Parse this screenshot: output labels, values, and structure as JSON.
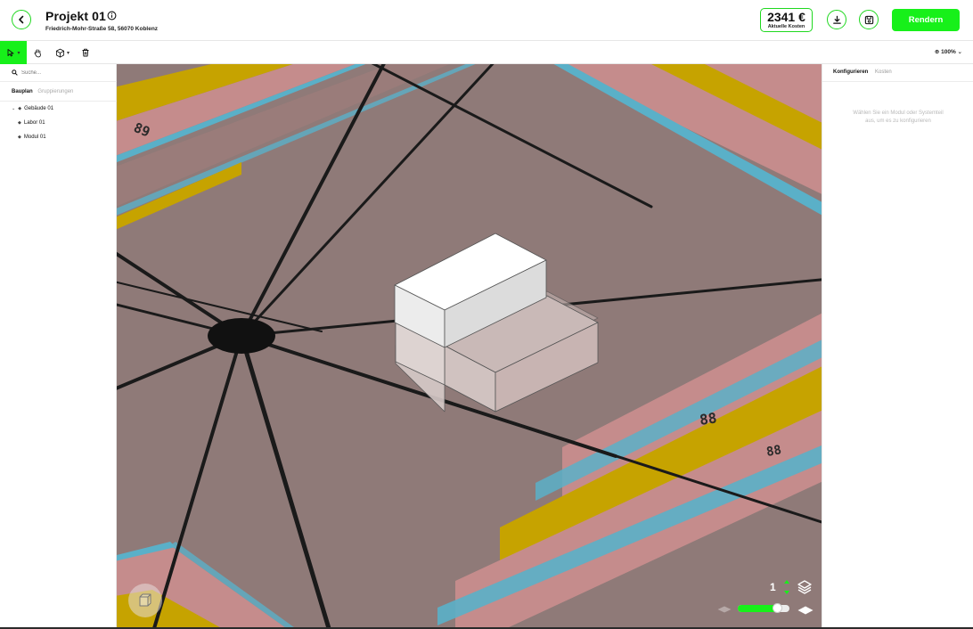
{
  "header": {
    "title": "Projekt 01",
    "address": "Friedrich-Mohr-Straße 58, 56070 Koblenz",
    "cost_value": "2341 €",
    "cost_label": "Aktuelle Kosten",
    "render_label": "Rendern",
    "icons": {
      "back": "chevron-left-icon",
      "info": "info-icon",
      "download": "download-icon",
      "save": "save-icon"
    }
  },
  "toolbar": {
    "tools": [
      "select-icon",
      "hand-icon",
      "cube-icon",
      "trash-icon"
    ],
    "zoom_label": "100%"
  },
  "sidebar_left": {
    "search_placeholder": "Suche...",
    "tabs": [
      {
        "label": "Bauplan",
        "active": true
      },
      {
        "label": "Gruppierungen",
        "active": false
      }
    ],
    "tree": [
      {
        "label": "Gebäude 01",
        "bullet": "◆",
        "expander": "⌄"
      },
      {
        "label": "Labor 01",
        "bullet": "◆"
      },
      {
        "label": "Modul 01",
        "bullet": "◆"
      }
    ]
  },
  "viewport": {
    "floor_count": "1",
    "slider_level": 0.75
  },
  "sidebar_right": {
    "tabs": [
      {
        "label": "Konfigurieren",
        "active": true
      },
      {
        "label": "Kosten",
        "active": false
      }
    ],
    "hint": "Wählen Sie ein Modul oder Systemteil aus, um es zu konfigurieren"
  },
  "colors": {
    "accent": "#17f01a",
    "ground": "#8f7a78",
    "road": "#c58c8c",
    "road_edge": "#5ab0c8",
    "field": "#c6a300",
    "line": "#1a1a1a"
  }
}
